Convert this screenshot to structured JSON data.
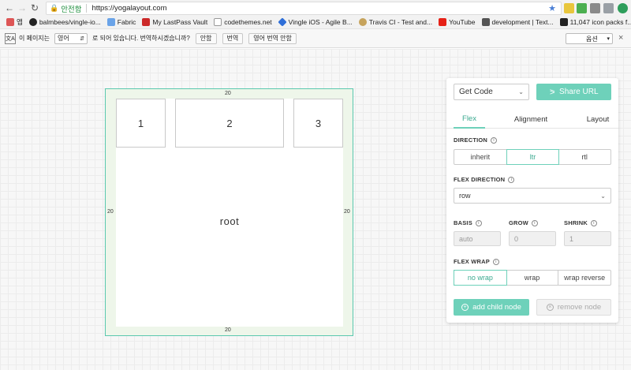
{
  "browser": {
    "secure_label": "안전함",
    "url": "https://yogalayout.com",
    "bookmarks": [
      {
        "label": "앱",
        "color": "#8ab4f8"
      },
      {
        "label": "balmbees/vingle-io...",
        "color": "#222222"
      },
      {
        "label": "Fabric",
        "color": "#6aa3e8"
      },
      {
        "label": "My LastPass Vault",
        "color": "#cc2929"
      },
      {
        "label": "codethemes.net",
        "color": "#999999"
      },
      {
        "label": "Vingle iOS - Agile B...",
        "color": "#2f6fd8"
      },
      {
        "label": "Travis CI - Test and...",
        "color": "#c6a35c"
      },
      {
        "label": "YouTube",
        "color": "#e62117"
      },
      {
        "label": "development | Text...",
        "color": "#555555"
      },
      {
        "label": "11,047 icon packs f...",
        "color": "#222222"
      }
    ]
  },
  "translate_bar": {
    "icon": "translate-icon",
    "prefix": "이 페이지는",
    "language": "영어",
    "suffix": "로 되어 있습니다. 번역하시겠습니까?",
    "btn_no": "안함",
    "btn_translate": "번역",
    "btn_never": "영어 번역 안함",
    "options": "옵션"
  },
  "canvas": {
    "padding_top": "20",
    "padding_bottom": "20",
    "padding_left": "20",
    "padding_right": "20",
    "child1": "1",
    "child2": "2",
    "child3": "3",
    "root_label": "root"
  },
  "panel": {
    "get_code": "Get Code",
    "share_url": "Share URL",
    "tabs": [
      "Flex",
      "Alignment",
      "Layout"
    ],
    "direction_label": "DIRECTION",
    "direction_options": [
      "inherit",
      "ltr",
      "rtl"
    ],
    "flex_direction_label": "FLEX DIRECTION",
    "flex_direction_value": "row",
    "basis_label": "BASIS",
    "grow_label": "GROW",
    "shrink_label": "SHRINK",
    "basis_placeholder": "auto",
    "grow_placeholder": "0",
    "shrink_placeholder": "1",
    "flex_wrap_label": "FLEX WRAP",
    "flex_wrap_options": [
      "no wrap",
      "wrap",
      "wrap reverse"
    ],
    "add_child": "add child node",
    "remove_node": "remove node"
  },
  "colors": {
    "accent": "#6ed1ba",
    "accent_text": "#3aa98f"
  }
}
